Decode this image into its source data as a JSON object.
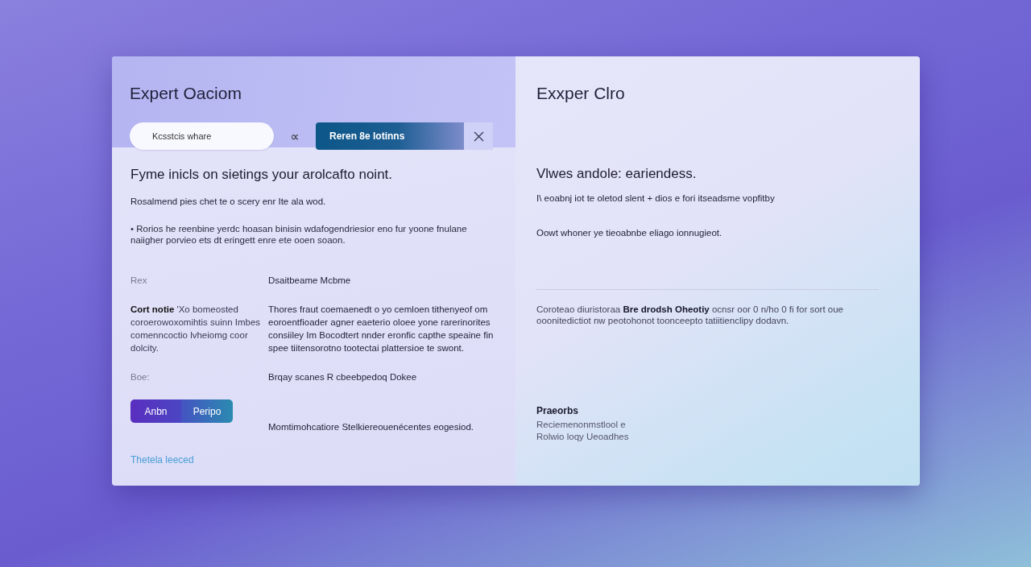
{
  "left_panel": {
    "title": "Expert Oaciom",
    "search": {
      "value": "Kcsstcis whare"
    },
    "symbol_button": "∝",
    "primary_button": "Reren 8e lotinns",
    "heading": "Fyme inicls on sietings your arolcafto noint.",
    "subtitle": "Rosalmend pies chet te o scery enr Ite ala wod.",
    "bullet": "• Rorios he reenbine yerdc hoasan binisin wdafogendriesior eno fur yoone fnulane naiigher porvieo ets dt eringett enre ete ooen soaon.",
    "details": [
      {
        "kind": "field",
        "label": "Rex",
        "value": "Dsaitbeame Mcbme"
      },
      {
        "kind": "note",
        "label": "**Cort notie** 'Xo bomeosted coroerowoxomihtis suinn Imbes comenncoctio lvheiomg coor dolcity.",
        "value": "Thores fraut coemaenedt o yo cemloen tithenyeof om eoroentfioader agner eaeterio oloee yone rarerinorites consiiley Im Bocodtert nnder eronfic capthe speaine fin spee tiitensorotno tootectai plattersioe te swont."
      },
      {
        "kind": "field",
        "label": "Boe:",
        "value": "Brqay scanes R cbeebpedoq Dokee"
      }
    ],
    "actions": {
      "buttons": [
        "Anbn",
        "Peripo"
      ],
      "caption": "Momtimohcatiore Stelkiereouenécentes eogesiod."
    },
    "link": "Thetela leeced"
  },
  "right_panel": {
    "title": "Exxper Clro",
    "heading": "Vlwes andole: eariendess.",
    "subtitle": "I\\ eoabnj iot te oletod slent + dios e fori itseadsme vopfitby",
    "text": "Oowt whoner ye tieoabnbe eliago ionnugieot.",
    "paragraph": "Coroteao diuristoraa **Bre drodsh Oheotiy** ocnsr oor 0 n/ho 0 fi for sort oue ooonitedictiot nw peotohonot toonceepto tatiitienclipy dodavn.",
    "footer": {
      "title": "Praeorbs",
      "lines": [
        "Reciemenonmstlool e",
        "Rolwio loqy Ueoadhes"
      ]
    }
  }
}
